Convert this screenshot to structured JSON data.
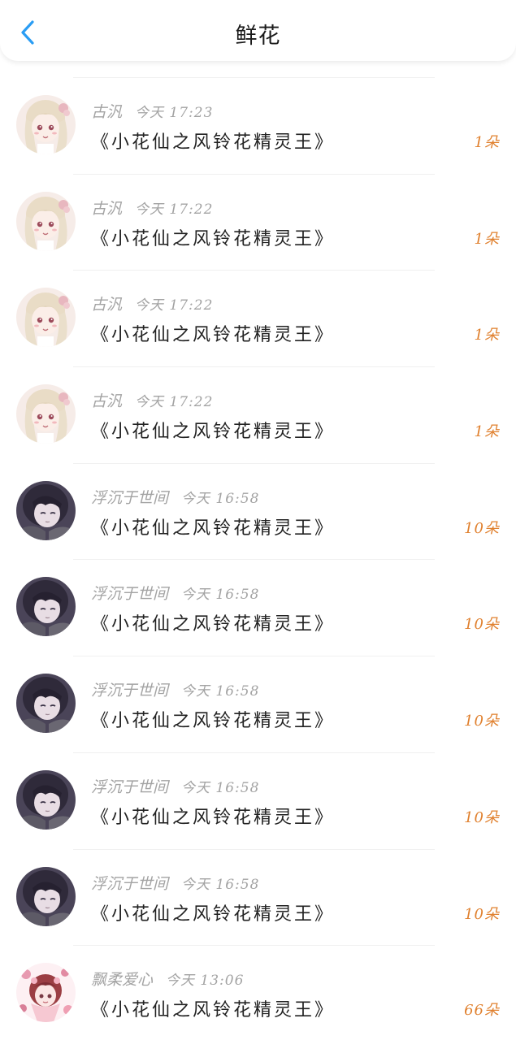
{
  "header": {
    "title": "鲜花",
    "back_icon": "chevron-left-icon",
    "accent": "#2a9df4"
  },
  "colors": {
    "amount": "#e0802e",
    "meta": "#a3a3a3"
  },
  "records": [
    {
      "avatar": "blonde-girl",
      "name": "古汎",
      "time": "今天 17:23",
      "book": "《小花仙之风铃花精灵王》",
      "amount": "1朵"
    },
    {
      "avatar": "blonde-girl",
      "name": "古汎",
      "time": "今天 17:22",
      "book": "《小花仙之风铃花精灵王》",
      "amount": "1朵"
    },
    {
      "avatar": "blonde-girl",
      "name": "古汎",
      "time": "今天 17:22",
      "book": "《小花仙之风铃花精灵王》",
      "amount": "1朵"
    },
    {
      "avatar": "blonde-girl",
      "name": "古汎",
      "time": "今天 17:22",
      "book": "《小花仙之风铃花精灵王》",
      "amount": "1朵"
    },
    {
      "avatar": "dark-hair-girl",
      "name": "浮沉于世间",
      "time": "今天 16:58",
      "book": "《小花仙之风铃花精灵王》",
      "amount": "10朵"
    },
    {
      "avatar": "dark-hair-girl",
      "name": "浮沉于世间",
      "time": "今天 16:58",
      "book": "《小花仙之风铃花精灵王》",
      "amount": "10朵"
    },
    {
      "avatar": "dark-hair-girl",
      "name": "浮沉于世间",
      "time": "今天 16:58",
      "book": "《小花仙之风铃花精灵王》",
      "amount": "10朵"
    },
    {
      "avatar": "dark-hair-girl",
      "name": "浮沉于世间",
      "time": "今天 16:58",
      "book": "《小花仙之风铃花精灵王》",
      "amount": "10朵"
    },
    {
      "avatar": "dark-hair-girl",
      "name": "浮沉于世间",
      "time": "今天 16:58",
      "book": "《小花仙之风铃花精灵王》",
      "amount": "10朵"
    },
    {
      "avatar": "pink-girl",
      "name": "飘柔爱心",
      "time": "今天 13:06",
      "book": "《小花仙之风铃花精灵王》",
      "amount": "66朵"
    }
  ]
}
